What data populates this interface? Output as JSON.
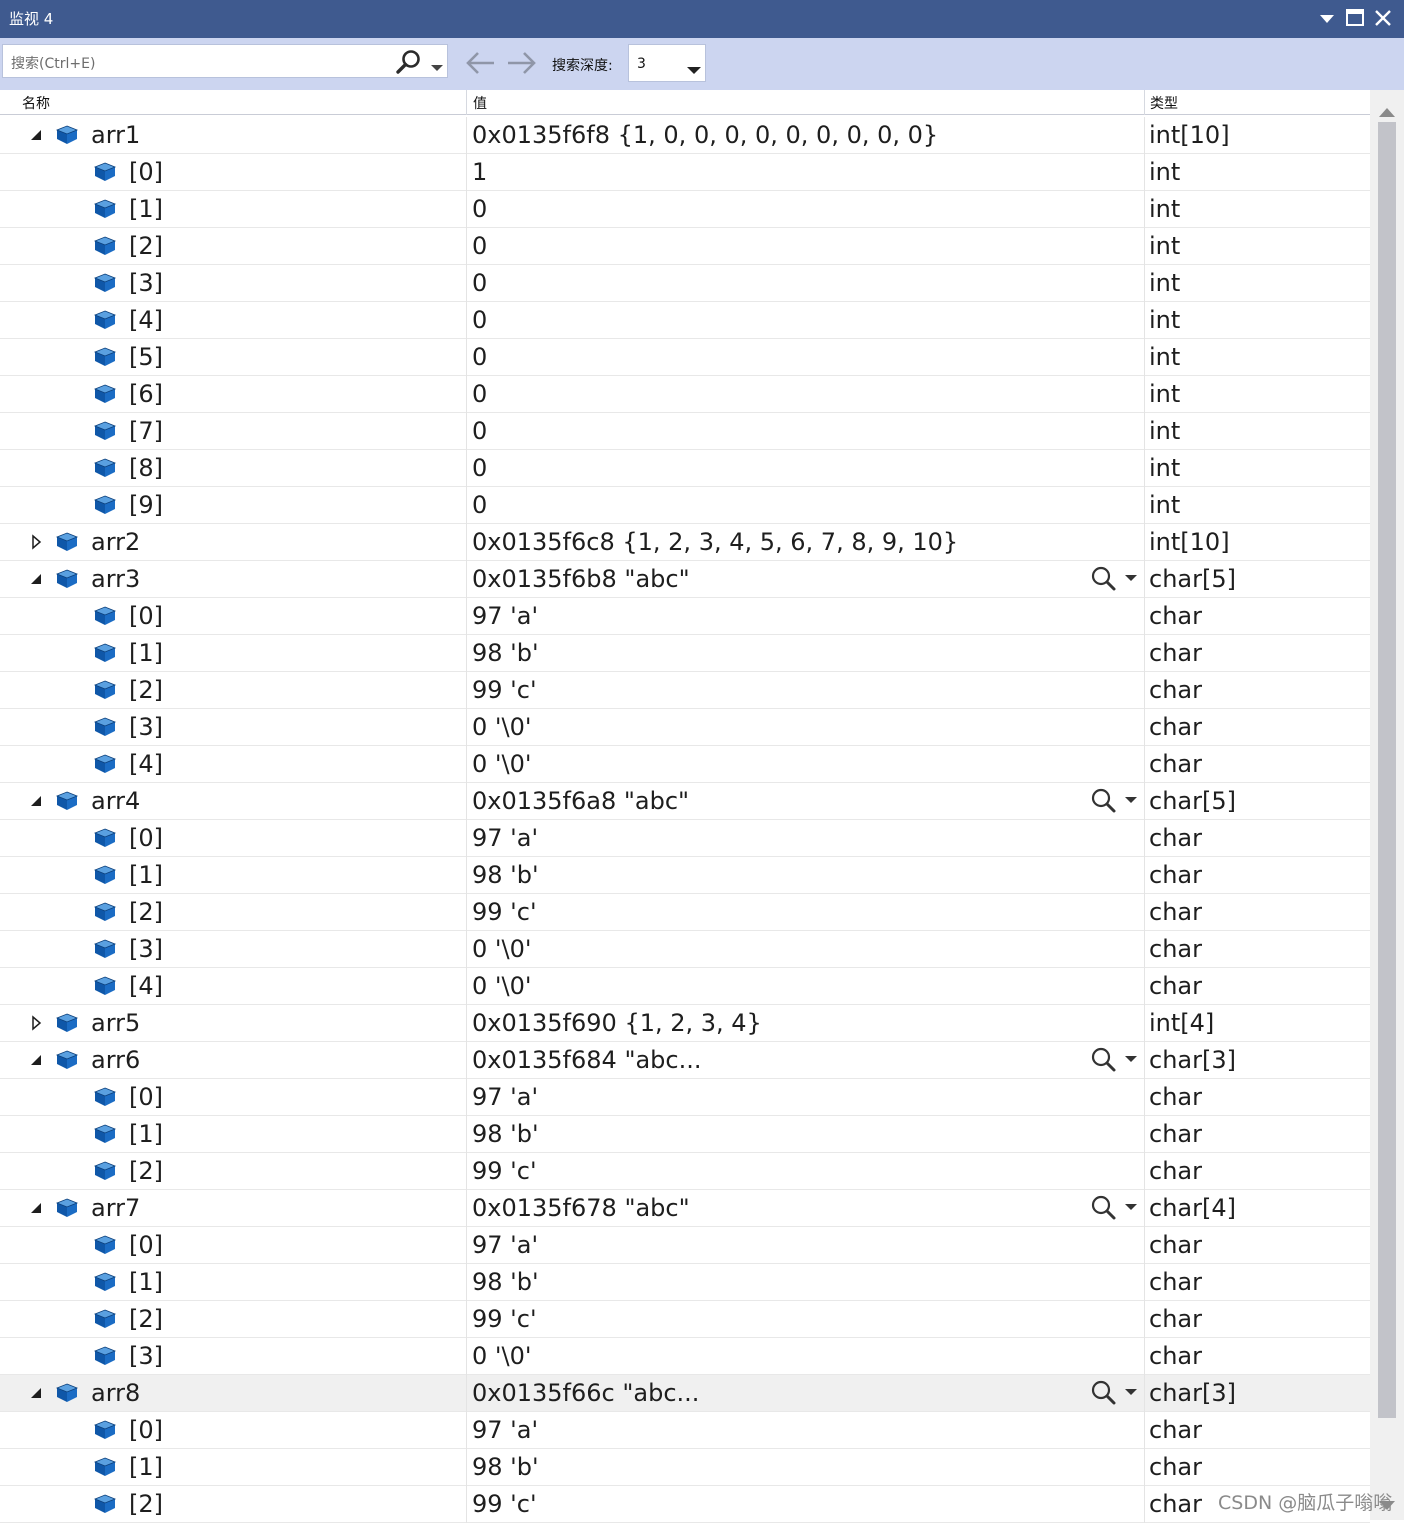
{
  "window": {
    "title": "监视 4"
  },
  "toolbar": {
    "search_placeholder": "搜索(Ctrl+E)",
    "depth_label": "搜索深度:",
    "depth_value": "3"
  },
  "columns": {
    "name": "名称",
    "value": "值",
    "type": "类型"
  },
  "rows": [
    {
      "level": 0,
      "expand": "open",
      "name": "arr1",
      "value": "0x0135f6f8 {1, 0, 0, 0, 0, 0, 0, 0, 0, 0}",
      "type": "int[10]",
      "lens": false
    },
    {
      "level": 1,
      "expand": "none",
      "name": "[0]",
      "value": "1",
      "type": "int",
      "lens": false
    },
    {
      "level": 1,
      "expand": "none",
      "name": "[1]",
      "value": "0",
      "type": "int",
      "lens": false
    },
    {
      "level": 1,
      "expand": "none",
      "name": "[2]",
      "value": "0",
      "type": "int",
      "lens": false
    },
    {
      "level": 1,
      "expand": "none",
      "name": "[3]",
      "value": "0",
      "type": "int",
      "lens": false
    },
    {
      "level": 1,
      "expand": "none",
      "name": "[4]",
      "value": "0",
      "type": "int",
      "lens": false
    },
    {
      "level": 1,
      "expand": "none",
      "name": "[5]",
      "value": "0",
      "type": "int",
      "lens": false
    },
    {
      "level": 1,
      "expand": "none",
      "name": "[6]",
      "value": "0",
      "type": "int",
      "lens": false
    },
    {
      "level": 1,
      "expand": "none",
      "name": "[7]",
      "value": "0",
      "type": "int",
      "lens": false
    },
    {
      "level": 1,
      "expand": "none",
      "name": "[8]",
      "value": "0",
      "type": "int",
      "lens": false
    },
    {
      "level": 1,
      "expand": "none",
      "name": "[9]",
      "value": "0",
      "type": "int",
      "lens": false
    },
    {
      "level": 0,
      "expand": "closed",
      "name": "arr2",
      "value": "0x0135f6c8 {1, 2, 3, 4, 5, 6, 7, 8, 9, 10}",
      "type": "int[10]",
      "lens": false
    },
    {
      "level": 0,
      "expand": "open",
      "name": "arr3",
      "value": "0x0135f6b8 \"abc\"",
      "type": "char[5]",
      "lens": true
    },
    {
      "level": 1,
      "expand": "none",
      "name": "[0]",
      "value": "97 'a'",
      "type": "char",
      "lens": false
    },
    {
      "level": 1,
      "expand": "none",
      "name": "[1]",
      "value": "98 'b'",
      "type": "char",
      "lens": false
    },
    {
      "level": 1,
      "expand": "none",
      "name": "[2]",
      "value": "99 'c'",
      "type": "char",
      "lens": false
    },
    {
      "level": 1,
      "expand": "none",
      "name": "[3]",
      "value": "0 '\\0'",
      "type": "char",
      "lens": false
    },
    {
      "level": 1,
      "expand": "none",
      "name": "[4]",
      "value": "0 '\\0'",
      "type": "char",
      "lens": false
    },
    {
      "level": 0,
      "expand": "open",
      "name": "arr4",
      "value": "0x0135f6a8 \"abc\"",
      "type": "char[5]",
      "lens": true
    },
    {
      "level": 1,
      "expand": "none",
      "name": "[0]",
      "value": "97 'a'",
      "type": "char",
      "lens": false
    },
    {
      "level": 1,
      "expand": "none",
      "name": "[1]",
      "value": "98 'b'",
      "type": "char",
      "lens": false
    },
    {
      "level": 1,
      "expand": "none",
      "name": "[2]",
      "value": "99 'c'",
      "type": "char",
      "lens": false
    },
    {
      "level": 1,
      "expand": "none",
      "name": "[3]",
      "value": "0 '\\0'",
      "type": "char",
      "lens": false
    },
    {
      "level": 1,
      "expand": "none",
      "name": "[4]",
      "value": "0 '\\0'",
      "type": "char",
      "lens": false
    },
    {
      "level": 0,
      "expand": "closed",
      "name": "arr5",
      "value": "0x0135f690 {1, 2, 3, 4}",
      "type": "int[4]",
      "lens": false
    },
    {
      "level": 0,
      "expand": "open",
      "name": "arr6",
      "value": "0x0135f684 \"abc...",
      "type": "char[3]",
      "lens": true
    },
    {
      "level": 1,
      "expand": "none",
      "name": "[0]",
      "value": "97 'a'",
      "type": "char",
      "lens": false
    },
    {
      "level": 1,
      "expand": "none",
      "name": "[1]",
      "value": "98 'b'",
      "type": "char",
      "lens": false
    },
    {
      "level": 1,
      "expand": "none",
      "name": "[2]",
      "value": "99 'c'",
      "type": "char",
      "lens": false
    },
    {
      "level": 0,
      "expand": "open",
      "name": "arr7",
      "value": "0x0135f678 \"abc\"",
      "type": "char[4]",
      "lens": true
    },
    {
      "level": 1,
      "expand": "none",
      "name": "[0]",
      "value": "97 'a'",
      "type": "char",
      "lens": false
    },
    {
      "level": 1,
      "expand": "none",
      "name": "[1]",
      "value": "98 'b'",
      "type": "char",
      "lens": false
    },
    {
      "level": 1,
      "expand": "none",
      "name": "[2]",
      "value": "99 'c'",
      "type": "char",
      "lens": false
    },
    {
      "level": 1,
      "expand": "none",
      "name": "[3]",
      "value": "0 '\\0'",
      "type": "char",
      "lens": false
    },
    {
      "level": 0,
      "expand": "open",
      "name": "arr8",
      "value": "0x0135f66c \"abc...",
      "type": "char[3]",
      "lens": true,
      "selected": true
    },
    {
      "level": 1,
      "expand": "none",
      "name": "[0]",
      "value": "97 'a'",
      "type": "char",
      "lens": false
    },
    {
      "level": 1,
      "expand": "none",
      "name": "[1]",
      "value": "98 'b'",
      "type": "char",
      "lens": false
    },
    {
      "level": 1,
      "expand": "none",
      "name": "[2]",
      "value": "99 'c'",
      "type": "char",
      "lens": false
    }
  ],
  "watermark": "CSDN @脑瓜子嗡嗡",
  "colors": {
    "titlebar": "#3f5a8f",
    "toolbar": "#ccd5f0",
    "cube": "#1565b8",
    "selected_row": "#f0f0f0"
  },
  "icons": {
    "variable": "cube-icon",
    "expand": "triangle-expand-icon",
    "visualizer": "magnifier-icon"
  }
}
